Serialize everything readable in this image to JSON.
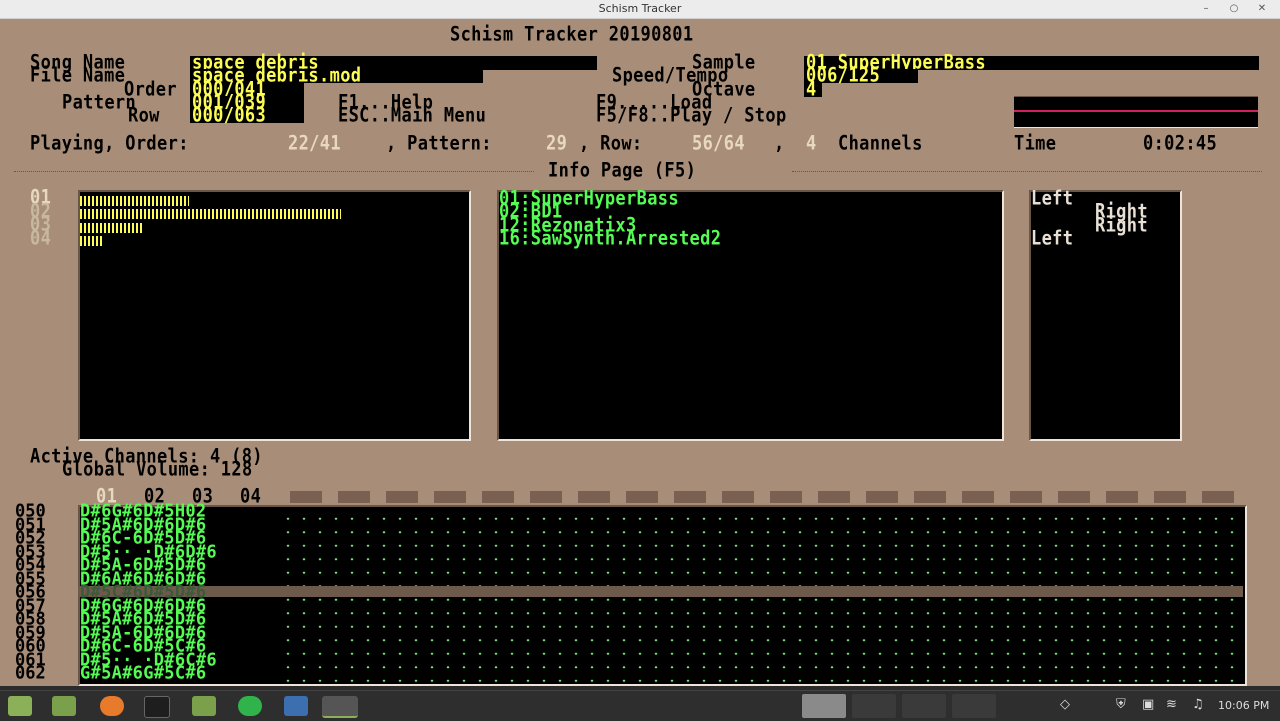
{
  "window": {
    "title": "Schism Tracker"
  },
  "app": {
    "heading": "Schism Tracker 20190801"
  },
  "header": {
    "song_name_label": "Song Name",
    "song_name": "space_debris",
    "file_name_label": "File Name",
    "file_name": "space_debris.mod",
    "order_label": "Order",
    "order": "000/041",
    "pattern_label": "Pattern",
    "pattern": "001/039",
    "row_label": "Row",
    "row": "000/063",
    "help": "F1...Help",
    "menu": "ESC..Main Menu",
    "load": "F9.....Load",
    "play": "F5/F8..Play / Stop",
    "sample_label": "Sample",
    "sample": "01 SuperHyperBass",
    "speed_label": "Speed/Tempo",
    "speed": "006/125",
    "octave_label": "Octave",
    "octave": "4"
  },
  "status": {
    "playing_label": "Playing, Order:",
    "order": "22/41",
    "pattern_label": ", Pattern:",
    "pattern": "29",
    "row_label": ", Row:",
    "row": "56/64",
    "channels_sep": ",",
    "channels": "4",
    "channels_label": "Channels",
    "time_label": "Time",
    "time": "0:02:45"
  },
  "info_page_title": "Info Page (F5)",
  "channels": [
    {
      "num": "01",
      "level": 0.28
    },
    {
      "num": "02",
      "level": 0.67
    },
    {
      "num": "03",
      "level": 0.16
    },
    {
      "num": "04",
      "level": 0.06
    }
  ],
  "samples": [
    "01:SuperHyperBass",
    "02:BD1",
    "12:Rezonatix3",
    "16:SawSynth.Arrested2"
  ],
  "panning": [
    "Left",
    "Right",
    "Right",
    "Left"
  ],
  "active_channels": "Active Channels: 4 (8)",
  "global_volume": "Global Volume: 128",
  "pattern_view": {
    "channel_headers": [
      "01",
      "02",
      "03",
      "04"
    ],
    "rows": [
      {
        "num": "050",
        "notes": "D#6G#6D#5H02"
      },
      {
        "num": "051",
        "notes": "D#5A#6D#6D#6"
      },
      {
        "num": "052",
        "notes": "D#6C-6D#5D#6"
      },
      {
        "num": "053",
        "notes": "D#5·· ·D#6D#6"
      },
      {
        "num": "054",
        "notes": "D#5A-6D#5D#6"
      },
      {
        "num": "055",
        "notes": "D#6A#6D#6D#6"
      },
      {
        "num": "056",
        "notes": "D#5C#6D#5D#6"
      },
      {
        "num": "057",
        "notes": "D#6G#6D#6D#6"
      },
      {
        "num": "058",
        "notes": "D#5A#6D#5D#6"
      },
      {
        "num": "059",
        "notes": "D#5A-6D#6D#6"
      },
      {
        "num": "060",
        "notes": "D#6C-6D#5C#6"
      },
      {
        "num": "061",
        "notes": "D#5·· ·D#6C#6"
      },
      {
        "num": "062",
        "notes": "G#5A#6G#5C#6"
      }
    ]
  },
  "taskbar": {
    "clock": "10:06 PM",
    "apps": [
      "menu-icon",
      "files-icon",
      "firefox-icon",
      "terminal-icon",
      "folder-icon",
      "whatsapp-icon",
      "camera-icon",
      "schism-icon"
    ],
    "accent": "#8bb158"
  }
}
